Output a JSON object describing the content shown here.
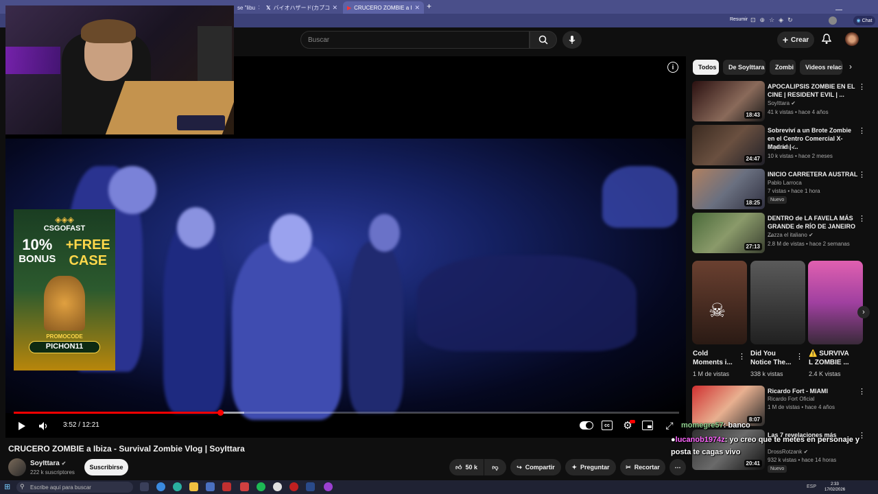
{
  "browser": {
    "tabs": [
      {
        "label": "se \"libu",
        "active": false
      },
      {
        "label": "バイオハザード(カプコン公式 on X: \"最",
        "active": false
      },
      {
        "label": "CRUCERO ZOMBIE a Ibiza - S",
        "active": true
      }
    ],
    "summarize_label": "Resumir",
    "chat_label": "Chat"
  },
  "youtube": {
    "search_placeholder": "Buscar",
    "create_label": "Crear"
  },
  "player": {
    "time": "3:52 / 12:21",
    "progress_fraction": 0.31,
    "ad": {
      "brand": "CSGOFAST",
      "line1": "10%",
      "line2": "BONUS",
      "line3": "+FREE",
      "line4": "CASE",
      "promo_label": "PROMOCODE",
      "promo_code": "PICHON11"
    }
  },
  "video": {
    "title": "CRUCERO ZOMBIE a Ibiza - Survival Zombie Vlog | SoyIttara",
    "channel": "SoyIttara",
    "subscribers": "222 k suscriptores",
    "subscribe_label": "Suscribirse",
    "likes": "50 k",
    "share_label": "Compartir",
    "ask_label": "Preguntar",
    "clip_label": "Recortar"
  },
  "chips": [
    "Todos",
    "De SoyIttara",
    "Zombi",
    "Videos relacio"
  ],
  "related": [
    {
      "title": "APOCALIPSIS ZOMBIE EN EL CINE | RESIDENT EVIL | ...",
      "channel": "SoyIttara",
      "meta": "41 k vistas • hace 4 años",
      "duration": "18:43",
      "badge": ""
    },
    {
      "title": "Sobreviví a un Brote Zombie en el Centro Comercial X-Madrid | ...",
      "channel": "SoyIttara",
      "meta": "10 k vistas • hace 2 meses",
      "duration": "24:47",
      "badge": ""
    },
    {
      "title": "INICIO CARRETERA AUSTRAL",
      "channel": "Pablo Larroca",
      "meta": "7 vistas • hace 1 hora",
      "duration": "18:25",
      "badge": "Nuevo"
    },
    {
      "title": "DENTRO de LA FAVELA MÁS GRANDE de RÍO DE JANEIRO ...",
      "channel": "Zazza el italiano",
      "meta": "2.8 M de vistas • hace 2 semanas",
      "duration": "27:13",
      "badge": ""
    }
  ],
  "shorts": [
    {
      "title": "Cold Moments i...",
      "views": "1 M de vistas"
    },
    {
      "title": "Did You Notice The...",
      "views": "338 k vistas"
    },
    {
      "title": "⚠️ SURVIVA L ZOMBIE ...",
      "views": "2.4 K vistas"
    }
  ],
  "related2": [
    {
      "title": "Ricardo Fort - MIAMI",
      "channel": "Ricardo Fort Oficial",
      "meta": "1 M de vistas • hace 4 años",
      "duration": "8:07",
      "badge": ""
    },
    {
      "title": "Las 7 revelaciones más",
      "channel": "DrossRotzank",
      "meta": "932 k vistas • hace 14 horas",
      "duration": "20:41",
      "badge": "Nuevo"
    }
  ],
  "chat": [
    {
      "user": "momegre57",
      "text": ": banco"
    },
    {
      "user": "lucanob1974z",
      "text": ": yo creo que te metes en personaje y"
    },
    {
      "user": "",
      "text": "posta te cagas vivo"
    }
  ],
  "taskbar": {
    "search_placeholder": "Escribe aquí para buscar",
    "lang": "ESP",
    "time": "2:33",
    "date": "17/02/2026"
  }
}
